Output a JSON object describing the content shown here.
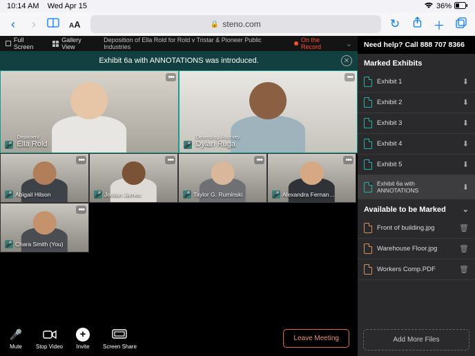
{
  "status": {
    "time": "10:14 AM",
    "date": "Wed Apr 15",
    "battery": "36%"
  },
  "browser": {
    "url_host": "steno.com"
  },
  "toolbar": {
    "fullscreen": "Full Screen",
    "gallery": "Gallery View",
    "case_title": "Deposition of Ella Rold for Rold v Tristar & Pioneer Public Industries",
    "record_label": "On the Record"
  },
  "banner": {
    "text": "Exhibit 6a with ANNOTATIONS was introduced."
  },
  "participants_main": [
    {
      "role": "Deponent",
      "name": "Ella Rold"
    },
    {
      "role": "Defending Attorney",
      "name": "Dylan Ruga"
    }
  ],
  "participants_thumbs": [
    {
      "name": "Abigail Hilson"
    },
    {
      "name": "Jordan James"
    },
    {
      "name": "Taylor G. Ruminski"
    },
    {
      "name": "Alexandra Fernan…"
    },
    {
      "name": "Chara Smith (You)"
    }
  ],
  "controls": {
    "mute": "Mute",
    "stop_video": "Stop Video",
    "invite": "Invite",
    "screen_share": "Screen Share",
    "leave": "Leave Meeting"
  },
  "sidebar": {
    "help": "Need help? Call 888 707 8366",
    "marked_title": "Marked Exhibits",
    "exhibits": [
      {
        "label": "Exhibit 1"
      },
      {
        "label": "Exhibit 2"
      },
      {
        "label": "Exhibit 3"
      },
      {
        "label": "Exhibit 4"
      },
      {
        "label": "Exhibit 5"
      },
      {
        "label": "Exhibit 6a with ANNOTATIONS",
        "selected": true
      }
    ],
    "available_title": "Available to be Marked",
    "available": [
      {
        "label": "Front of building.jpg"
      },
      {
        "label": "Warehouse Floor.jpg"
      },
      {
        "label": "Workers Comp.PDF"
      }
    ],
    "add_files": "Add More Files"
  }
}
